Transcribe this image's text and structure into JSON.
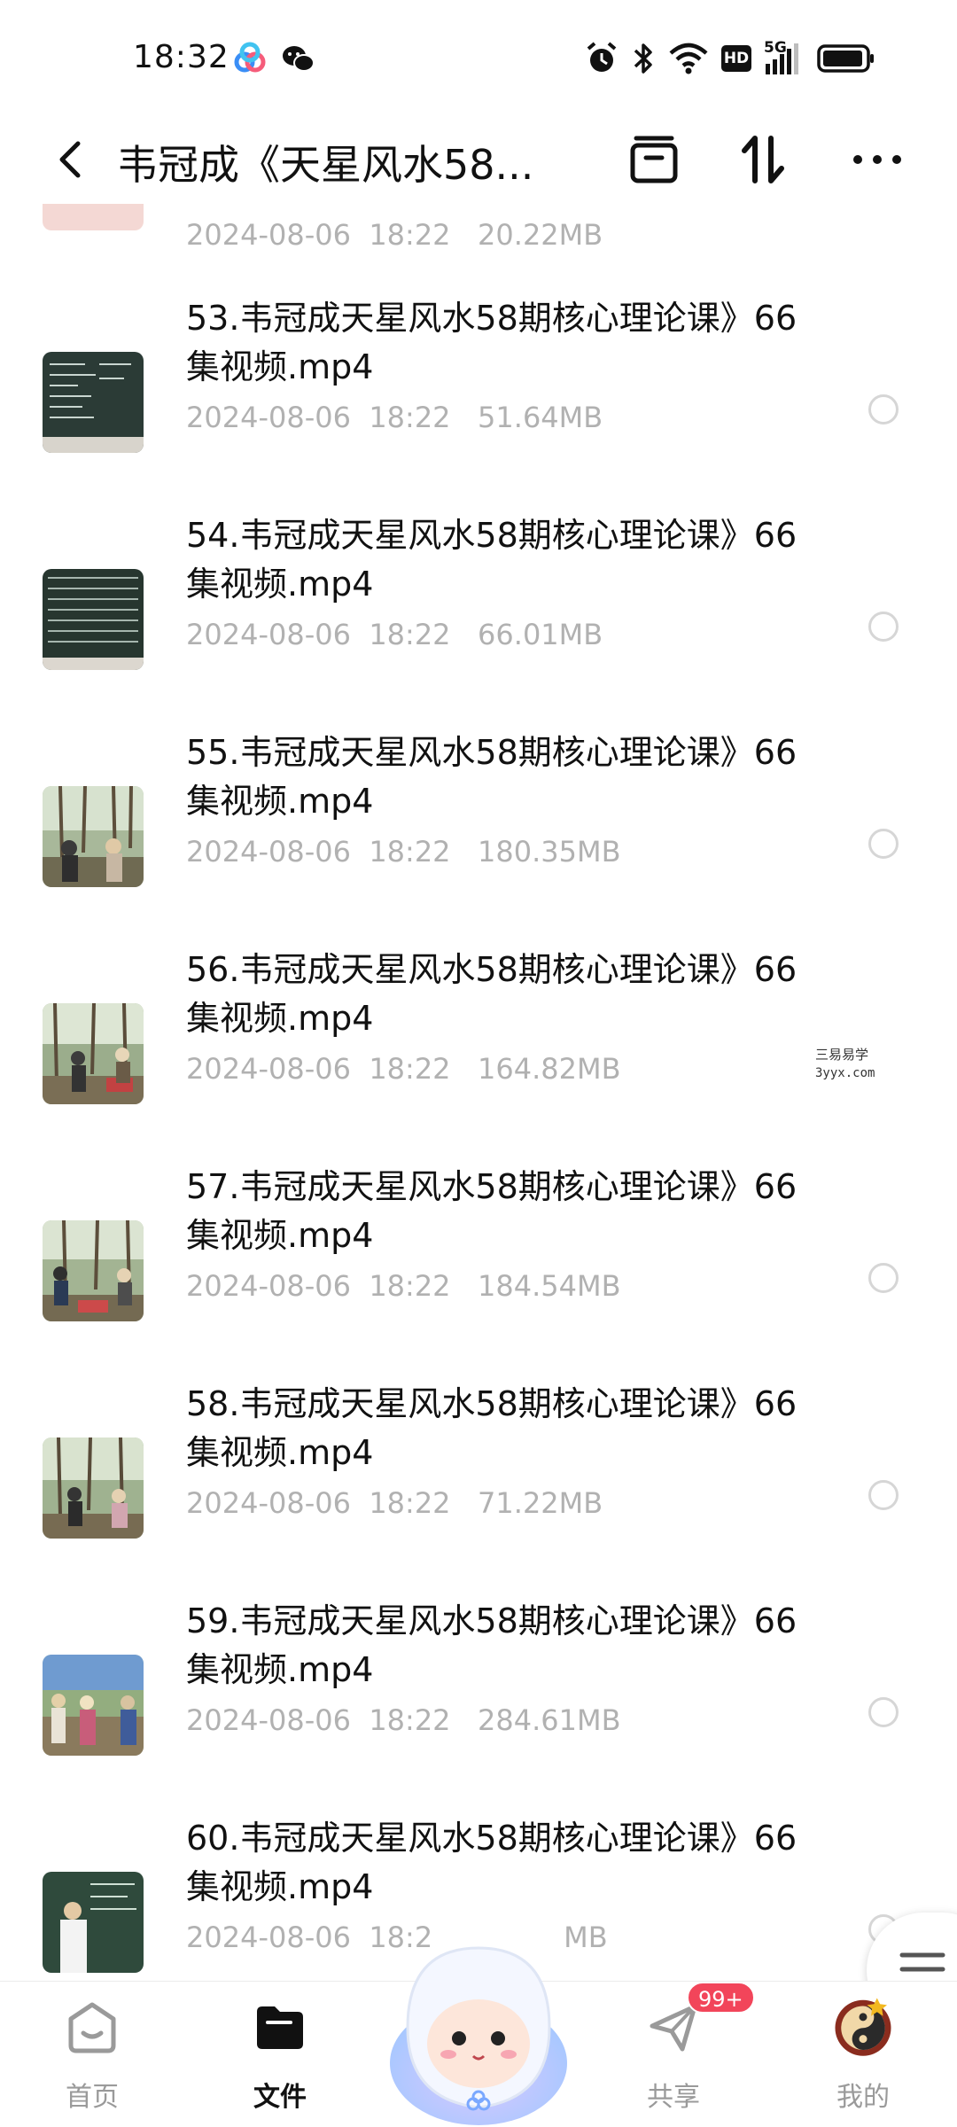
{
  "status_bar": {
    "time": "18:32",
    "app_icons": [
      "baidu-netdisk-icon",
      "wechat-icon"
    ],
    "indicators": [
      "alarm-icon",
      "bluetooth-icon",
      "wifi-icon",
      "hd-icon",
      "signal-5g-icon",
      "battery-icon"
    ],
    "hd_label": "HD",
    "network_label": "5G"
  },
  "header": {
    "title": "韦冠成《天星风水58...",
    "actions": [
      "archive-icon",
      "sort-icon",
      "more-icon"
    ]
  },
  "partial_top_item": {
    "meta": "2024-08-06  18:22   20.22MB"
  },
  "files": [
    {
      "name": "53.韦冠成天星风水58期核心理论课》66集视频.mp4",
      "meta": "2024-08-06  18:22   51.64MB",
      "thumb": "blackboard"
    },
    {
      "name": "54.韦冠成天星风水58期核心理论课》66集视频.mp4",
      "meta": "2024-08-06  18:22   66.01MB",
      "thumb": "blackboard"
    },
    {
      "name": "55.韦冠成天星风水58期核心理论课》66集视频.mp4",
      "meta": "2024-08-06  18:22   180.35MB",
      "thumb": "forest"
    },
    {
      "name": "56.韦冠成天星风水58期核心理论课》66集视频.mp4",
      "meta": "2024-08-06  18:22   164.82MB",
      "thumb": "forest"
    },
    {
      "name": "57.韦冠成天星风水58期核心理论课》66集视频.mp4",
      "meta": "2024-08-06  18:22   184.54MB",
      "thumb": "forest"
    },
    {
      "name": "58.韦冠成天星风水58期核心理论课》66集视频.mp4",
      "meta": "2024-08-06  18:22   71.22MB",
      "thumb": "forest"
    },
    {
      "name": "59.韦冠成天星风水58期核心理论课》66集视频.mp4",
      "meta": "2024-08-06  18:22   284.61MB",
      "thumb": "forest"
    },
    {
      "name": "60.韦冠成天星风水58期核心理论课》66集视频.mp4",
      "meta": "2024-08-06  18:2",
      "meta_tail": "MB",
      "thumb": "classroom"
    }
  ],
  "watermark": {
    "line1": "三易易学",
    "line2": "3yyx.com"
  },
  "bottom_nav": {
    "items": [
      {
        "label": "首页",
        "icon": "home-icon",
        "active": false
      },
      {
        "label": "文件",
        "icon": "folder-icon",
        "active": true
      },
      {
        "label": "共享",
        "icon": "share-plane-icon",
        "active": false,
        "badge": "99+"
      },
      {
        "label": "我的",
        "icon": "avatar-icon",
        "active": false
      }
    ]
  },
  "colors": {
    "text_primary": "#111111",
    "text_secondary": "#b1b1b1",
    "badge": "#f2455a"
  }
}
